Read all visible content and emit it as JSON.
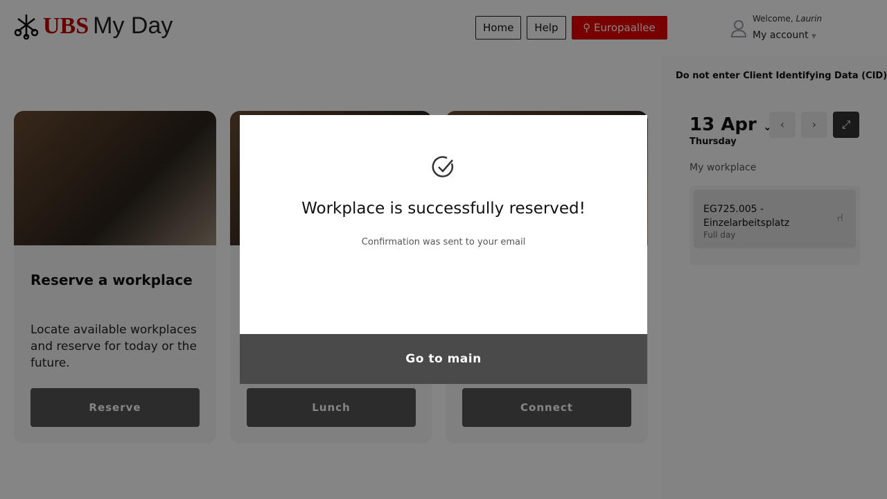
{
  "header": {
    "brand": "UBS",
    "app": "My Day",
    "nav": [
      "Home",
      "Help"
    ],
    "location": "Europaallee",
    "welcome_prefix": "Welcome, ",
    "user": "Laurin",
    "account": "My account"
  },
  "cards": [
    {
      "title": "Reserve a workplace",
      "text": "Locate available workplaces and reserve for today or the future.",
      "button": "Reserve"
    },
    {
      "title": "",
      "text": "",
      "button": "Lunch"
    },
    {
      "title": "",
      "text": "",
      "button": "Connect"
    }
  ],
  "side": {
    "cid": "Do not enter Client Identifying Data (CID)",
    "date": "13 Apr",
    "weekday": "Thursday",
    "my_workplace": "My workplace",
    "workplace": {
      "name": "EG725.005 - Einzelarbeitsplatz",
      "duration": "Full day"
    }
  },
  "modal": {
    "title": "Workplace is successfully reserved!",
    "message": "Confirmation was sent to your email",
    "button": "Go to main"
  },
  "colors": {
    "brand_red": "#e60000",
    "dark_button": "#333333"
  }
}
